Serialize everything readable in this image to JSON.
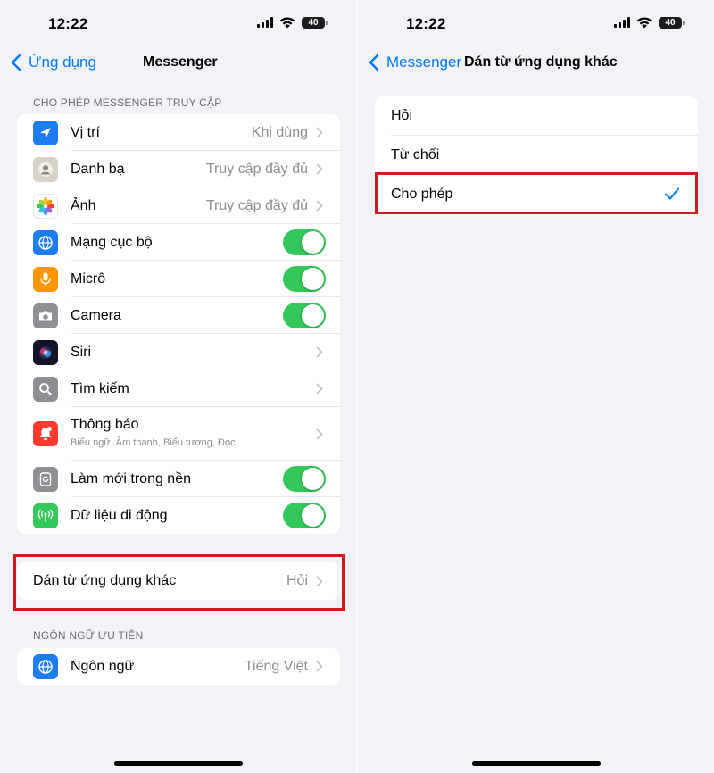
{
  "status_bar": {
    "time": "12:22",
    "battery": "40"
  },
  "left": {
    "nav": {
      "back_label": "Ứng dụng",
      "title": "Messenger"
    },
    "access_section": {
      "header": "CHO PHÉP MESSENGER TRUY CẬP",
      "items": [
        {
          "label": "Vị trí",
          "value": "Khi dùng",
          "type": "link",
          "icon": "location-arrow-icon",
          "color": "#1c7cf4"
        },
        {
          "label": "Danh bạ",
          "value": "Truy cập đầy đủ",
          "type": "link",
          "icon": "contacts-icon",
          "color": "#b9b3aa"
        },
        {
          "label": "Ảnh",
          "value": "Truy cập đầy đủ",
          "type": "link",
          "icon": "photos-icon",
          "color": "#ffffff"
        },
        {
          "label": "Mạng cục bộ",
          "value": "",
          "type": "toggle",
          "on": true,
          "icon": "globe-icon",
          "color": "#1c7cf4"
        },
        {
          "label": "Micrô",
          "value": "",
          "type": "toggle",
          "on": true,
          "icon": "microphone-icon",
          "color": "#ff9500"
        },
        {
          "label": "Camera",
          "value": "",
          "type": "toggle",
          "on": true,
          "icon": "camera-icon",
          "color": "#8e8e93"
        },
        {
          "label": "Siri",
          "value": "",
          "type": "link",
          "icon": "siri-icon",
          "color": "#1a1a2e"
        },
        {
          "label": "Tìm kiếm",
          "value": "",
          "type": "link",
          "icon": "search-icon",
          "color": "#8e8e93"
        },
        {
          "label": "Thông báo",
          "sub": "Biểu ngữ, Âm thanh, Biểu tượng, Đọc",
          "value": "",
          "type": "link",
          "icon": "notification-bell-icon",
          "color": "#ff3b30"
        },
        {
          "label": "Làm mới trong nền",
          "value": "",
          "type": "toggle",
          "on": true,
          "icon": "background-refresh-icon",
          "color": "#8e8e93"
        },
        {
          "label": "Dữ liệu di động",
          "value": "",
          "type": "toggle",
          "on": true,
          "icon": "cellular-antenna-icon",
          "color": "#34c759"
        }
      ]
    },
    "paste_row": {
      "label": "Dán từ ứng dụng khác",
      "value": "Hỏi"
    },
    "language_section": {
      "header": "NGÔN NGỮ ƯU TIÊN",
      "label": "Ngôn ngữ",
      "value": "Tiếng Việt",
      "icon": "globe-icon"
    }
  },
  "right": {
    "nav": {
      "back_label": "Messenger",
      "title": "Dán từ ứng dụng khác"
    },
    "options": [
      {
        "label": "Hỏi",
        "selected": false
      },
      {
        "label": "Từ chối",
        "selected": false
      },
      {
        "label": "Cho phép",
        "selected": true
      }
    ]
  },
  "colors": {
    "accent": "#007aff",
    "toggle_on": "#34c759",
    "highlight": "#d0191b",
    "background": "#f2f2f7"
  }
}
